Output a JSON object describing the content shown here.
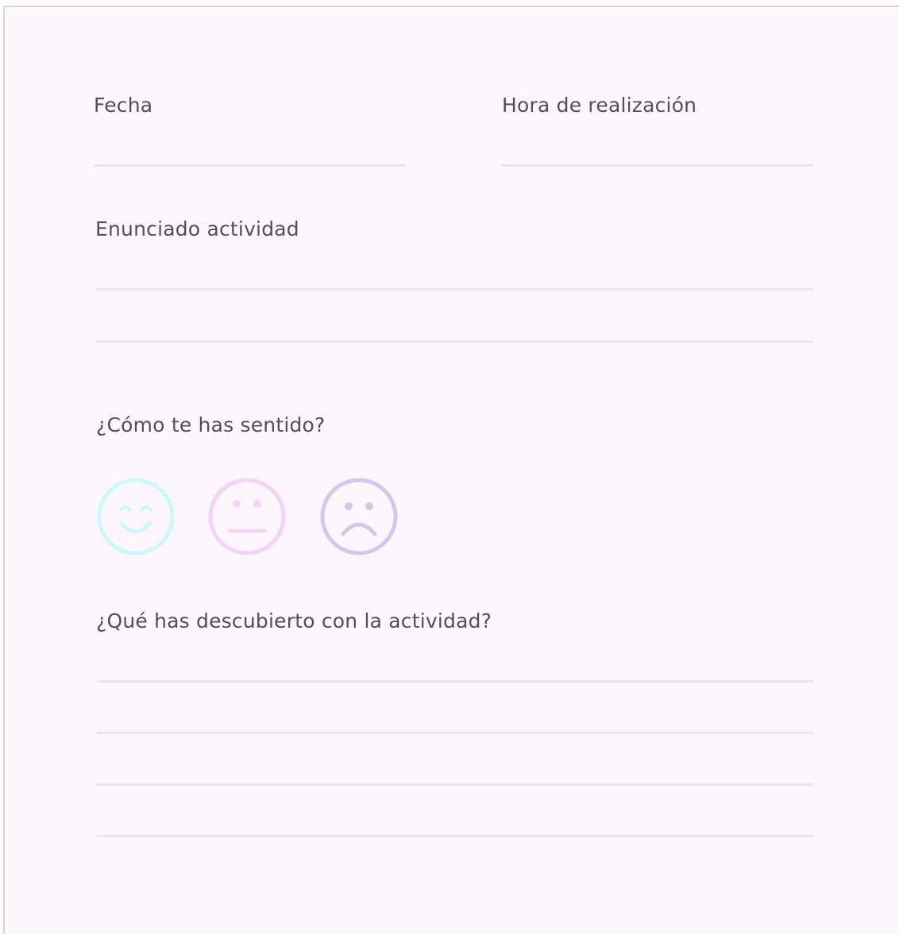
{
  "form": {
    "date_label": "Fecha",
    "time_label": "Hora de realización",
    "statement_label": "Enunciado actividad",
    "feeling_label": "¿Cómo te has sentido?",
    "discovery_label": "¿Qué has descubierto con la actividad?"
  },
  "moods": [
    {
      "icon": "happy-face-icon",
      "color": "#c9f9fc"
    },
    {
      "icon": "neutral-face-icon",
      "color": "#f5d2f7"
    },
    {
      "icon": "sad-face-icon",
      "color": "#cbcbeb"
    }
  ],
  "colors": {
    "background": "#fdf7fd",
    "border": "#d5d5e6",
    "line": "#e6e6ee",
    "text": "#4d4f63"
  }
}
